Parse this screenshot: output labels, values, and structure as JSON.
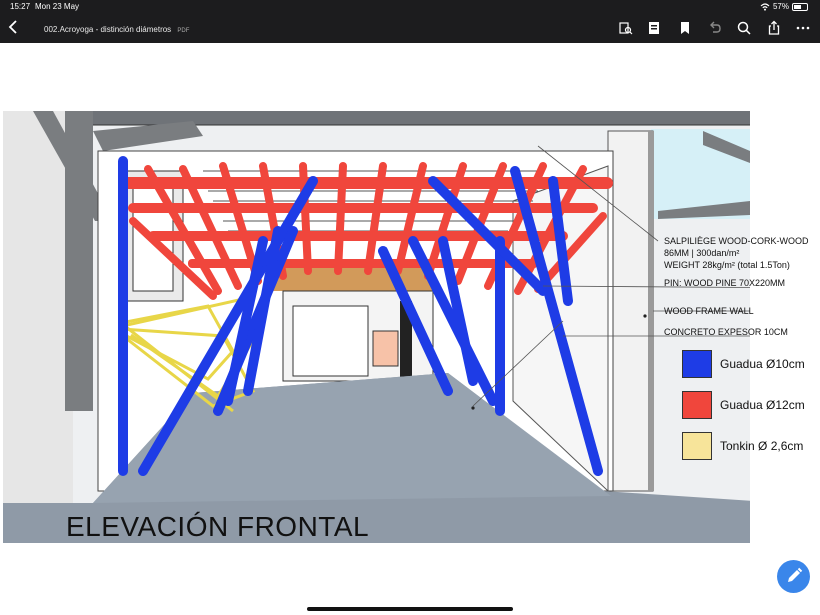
{
  "status": {
    "time": "15:27",
    "date": "Mon 23 May",
    "battery": "57%"
  },
  "toolbar": {
    "title": "002.Acroyoga - distinción diámetros",
    "kind": "PDF"
  },
  "drawing": {
    "title": "ELEVACIÓN FRONTAL",
    "annotations": [
      "SALPILIÈGE WOOD-CORK-WOOD",
      "86MM | 300dan/m²",
      "WEIGHT 28kg/m² (total 1.5Ton)",
      "PIN: WOOD PINE 70X220MM",
      "WOOD FRAME WALL",
      "CONCRETO EXPESOR 10CM"
    ],
    "legend": [
      {
        "label": "Guadua Ø10cm",
        "color": "#1e3ce6"
      },
      {
        "label": "Guadua Ø12cm",
        "color": "#f0463c"
      },
      {
        "label": "Tonkin Ø 2,6cm",
        "color": "#f7e49a"
      }
    ]
  },
  "icons": {
    "back": "chevron-left-icon",
    "edit": "pencil-icon"
  }
}
